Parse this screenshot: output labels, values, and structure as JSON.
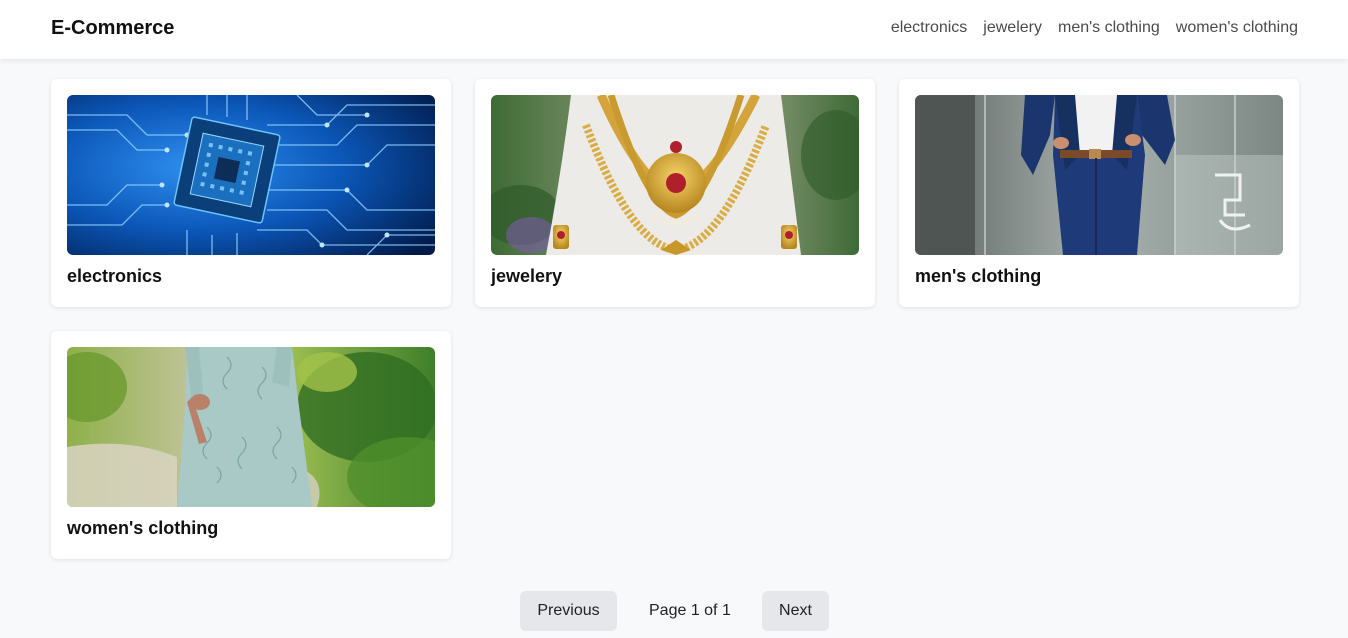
{
  "header": {
    "brand": "E-Commerce",
    "nav": [
      "electronics",
      "jewelery",
      "men's clothing",
      "women's clothing"
    ]
  },
  "categories": [
    {
      "title": "electronics",
      "image": "circuit-board-chip"
    },
    {
      "title": "jewelery",
      "image": "gold-necklace-on-stand"
    },
    {
      "title": "men's clothing",
      "image": "man-in-navy-suit"
    },
    {
      "title": "women's clothing",
      "image": "woman-in-printed-kurta"
    }
  ],
  "pagination": {
    "previous_label": "Previous",
    "page_text": "Page 1 of 1",
    "next_label": "Next"
  },
  "colors": {
    "background": "#f8f9fb",
    "card": "#ffffff",
    "button": "#e5e7eb"
  }
}
